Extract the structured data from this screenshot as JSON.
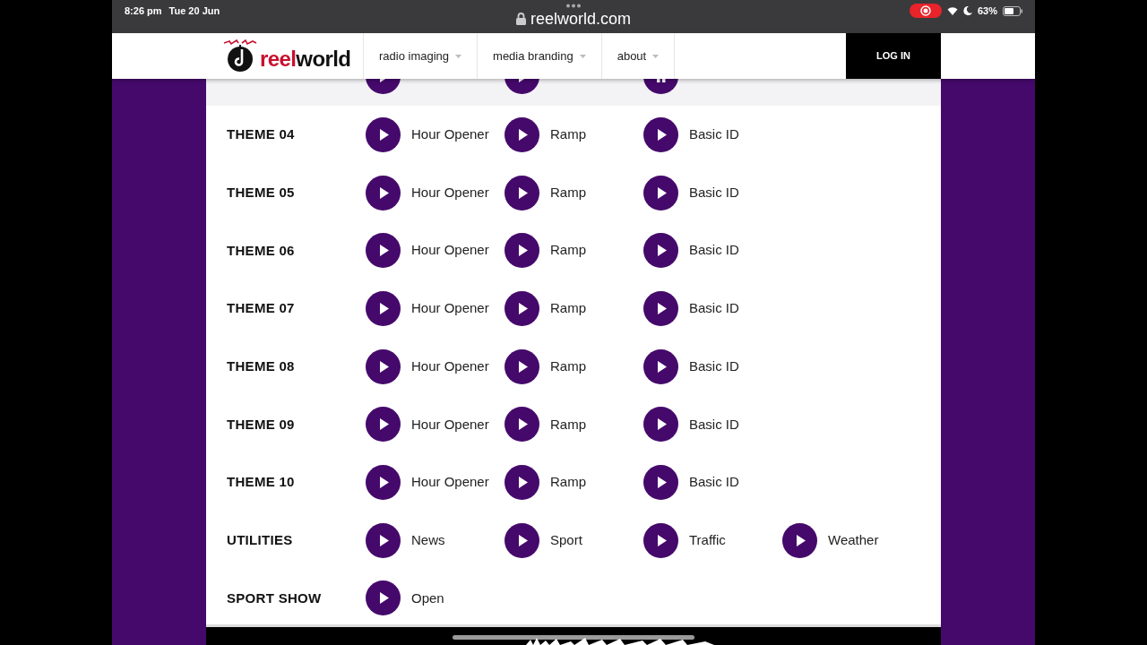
{
  "status_bar": {
    "time": "8:26 pm",
    "date": "Tue 20 Jun",
    "url": "reelworld.com",
    "recording": true,
    "battery": "63%"
  },
  "header": {
    "logo": [
      "reel",
      "world"
    ],
    "nav": [
      {
        "label": "radio imaging",
        "dropdown": true
      },
      {
        "label": "media branding",
        "dropdown": true
      },
      {
        "label": "about",
        "dropdown": true
      }
    ],
    "login": "LOG IN"
  },
  "partial_row": {
    "highlighted": true,
    "clips": [
      {
        "playing": false
      },
      {
        "playing": false
      },
      {
        "playing": true
      }
    ]
  },
  "rows": [
    {
      "label": "THEME 04",
      "clips": [
        {
          "title": "Hour Opener",
          "playing": false
        },
        {
          "title": "Ramp",
          "playing": false
        },
        {
          "title": "Basic ID",
          "playing": false
        }
      ]
    },
    {
      "label": "THEME 05",
      "clips": [
        {
          "title": "Hour Opener",
          "playing": false
        },
        {
          "title": "Ramp",
          "playing": false
        },
        {
          "title": "Basic ID",
          "playing": false
        }
      ]
    },
    {
      "label": "THEME 06",
      "clips": [
        {
          "title": "Hour Opener",
          "playing": false
        },
        {
          "title": "Ramp",
          "playing": false
        },
        {
          "title": "Basic ID",
          "playing": false
        }
      ]
    },
    {
      "label": "THEME 07",
      "clips": [
        {
          "title": "Hour Opener",
          "playing": false
        },
        {
          "title": "Ramp",
          "playing": false
        },
        {
          "title": "Basic ID",
          "playing": false
        }
      ]
    },
    {
      "label": "THEME 08",
      "clips": [
        {
          "title": "Hour Opener",
          "playing": false
        },
        {
          "title": "Ramp",
          "playing": false
        },
        {
          "title": "Basic ID",
          "playing": false
        }
      ]
    },
    {
      "label": "THEME 09",
      "clips": [
        {
          "title": "Hour Opener",
          "playing": false
        },
        {
          "title": "Ramp",
          "playing": false
        },
        {
          "title": "Basic ID",
          "playing": false
        }
      ]
    },
    {
      "label": "THEME 10",
      "clips": [
        {
          "title": "Hour Opener",
          "playing": false
        },
        {
          "title": "Ramp",
          "playing": false
        },
        {
          "title": "Basic ID",
          "playing": false
        }
      ]
    },
    {
      "label": "UTILITIES",
      "clips": [
        {
          "title": "News",
          "playing": false
        },
        {
          "title": "Sport",
          "playing": false
        },
        {
          "title": "Traffic",
          "playing": false
        },
        {
          "title": "Weather",
          "playing": false
        }
      ]
    },
    {
      "label": "SPORT SHOW",
      "clips": [
        {
          "title": "Open",
          "playing": false
        }
      ]
    }
  ]
}
